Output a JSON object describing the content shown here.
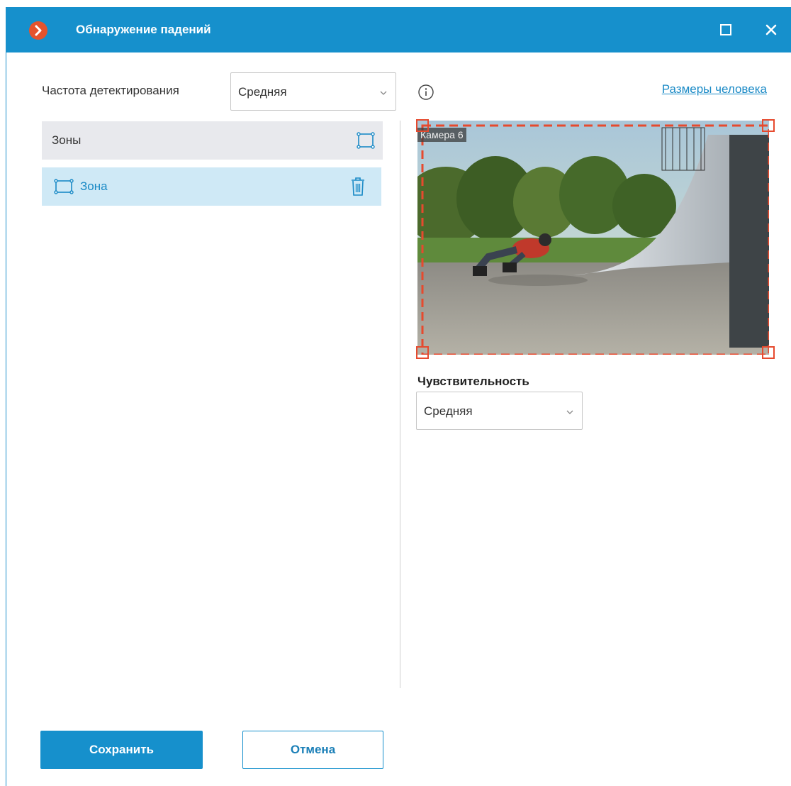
{
  "window": {
    "title": "Обнаружение падений",
    "accent_color": "#1690cc",
    "logo_icon": "chevron-right-icon"
  },
  "detection_frequency": {
    "label": "Частота детектирования",
    "selected": "Средняя"
  },
  "zones": {
    "header_label": "Зоны",
    "items": [
      {
        "label": "Зона"
      }
    ]
  },
  "human_size_link": "Размеры человека",
  "camera": {
    "label": "Камера 6",
    "zone_color": "#e64a2e"
  },
  "sensitivity": {
    "label": "Чувствительность",
    "selected": "Средняя"
  },
  "buttons": {
    "save": "Сохранить",
    "cancel": "Отмена"
  }
}
